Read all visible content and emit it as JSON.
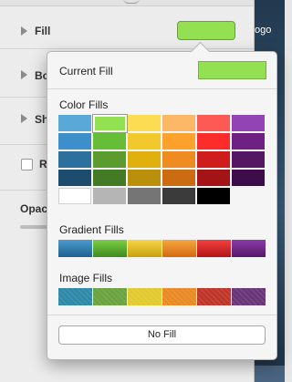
{
  "inspector": {
    "fill_label": "Fill",
    "border_label": "Bo",
    "shadow_label": "Sh",
    "reflection_label": "R",
    "opacity_label": "Opac",
    "fill_color": "#93e053"
  },
  "backdrop": {
    "text": "ogo"
  },
  "popover": {
    "current_fill_label": "Current Fill",
    "current_fill_color": "#93e053",
    "color_fills_label": "Color Fills",
    "gradient_fills_label": "Gradient Fills",
    "image_fills_label": "Image Fills",
    "no_fill_label": "No Fill",
    "color_grid": [
      [
        "#5aa8d8",
        "#93e053",
        "#fcdc52",
        "#fcb867",
        "#fd5955",
        "#9344b4"
      ],
      [
        "#3d8fcb",
        "#66bd36",
        "#f2c92c",
        "#fca12c",
        "#fb2c2a",
        "#6e2183"
      ],
      [
        "#2d709e",
        "#5c9c2f",
        "#e0b00f",
        "#ee8b21",
        "#cf1d1d",
        "#531763"
      ],
      [
        "#1e4c6e",
        "#437a24",
        "#b98f0b",
        "#cc6c12",
        "#a41315",
        "#3c0d4a"
      ],
      [
        "#ffffff",
        "#b5b5b5",
        "#757575",
        "#3b3b3b",
        "#000000",
        null
      ]
    ],
    "gradient_swatches": [
      {
        "from": "#4c9ccc",
        "to": "#1f5f8f"
      },
      {
        "from": "#7ccf45",
        "to": "#3f8a22"
      },
      {
        "from": "#f5d648",
        "to": "#c9a10e"
      },
      {
        "from": "#f7a641",
        "to": "#d26a12"
      },
      {
        "from": "#f24240",
        "to": "#b31316"
      },
      {
        "from": "#8d3aab",
        "to": "#521a66"
      }
    ],
    "image_swatches": [
      "#2f89a8",
      "#6aa33f",
      "#e1c92f",
      "#e98a25",
      "#c0352a",
      "#6a3579"
    ],
    "selected_cell": "#93e053"
  }
}
